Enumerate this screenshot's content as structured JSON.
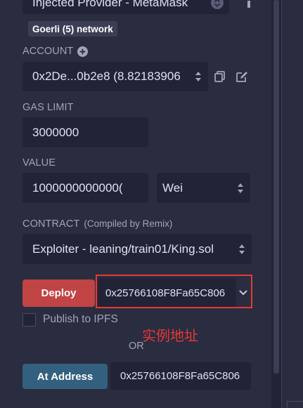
{
  "environment": {
    "selected": "Injected Provider - MetaMask",
    "network_badge": "Goerli (5) network",
    "info_icon": "info-icon"
  },
  "account": {
    "label": "ACCOUNT",
    "value": "0x2De...0b2e8 (8.82183906"
  },
  "gas_limit": {
    "label": "GAS LIMIT",
    "value": "3000000"
  },
  "value": {
    "label": "VALUE",
    "amount": "1000000000000(",
    "unit": "Wei"
  },
  "contract": {
    "label": "CONTRACT",
    "sub_label": "(Compiled by Remix)",
    "selected": "Exploiter - leaning/train01/King.sol"
  },
  "deploy": {
    "button": "Deploy",
    "constructor_arg": "0x25766108F8Fa65C806"
  },
  "publish_ipfs": {
    "label": "Publish to IPFS",
    "checked": false
  },
  "or_text": "OR",
  "annotation": {
    "text": "实例地址",
    "color": "#e53935"
  },
  "at_address": {
    "button": "At Address",
    "value": "0x25766108F8Fa65C806"
  },
  "colors": {
    "deploy_button": "#c14444",
    "at_address_button": "#33607e",
    "highlight_box": "#e53935"
  }
}
